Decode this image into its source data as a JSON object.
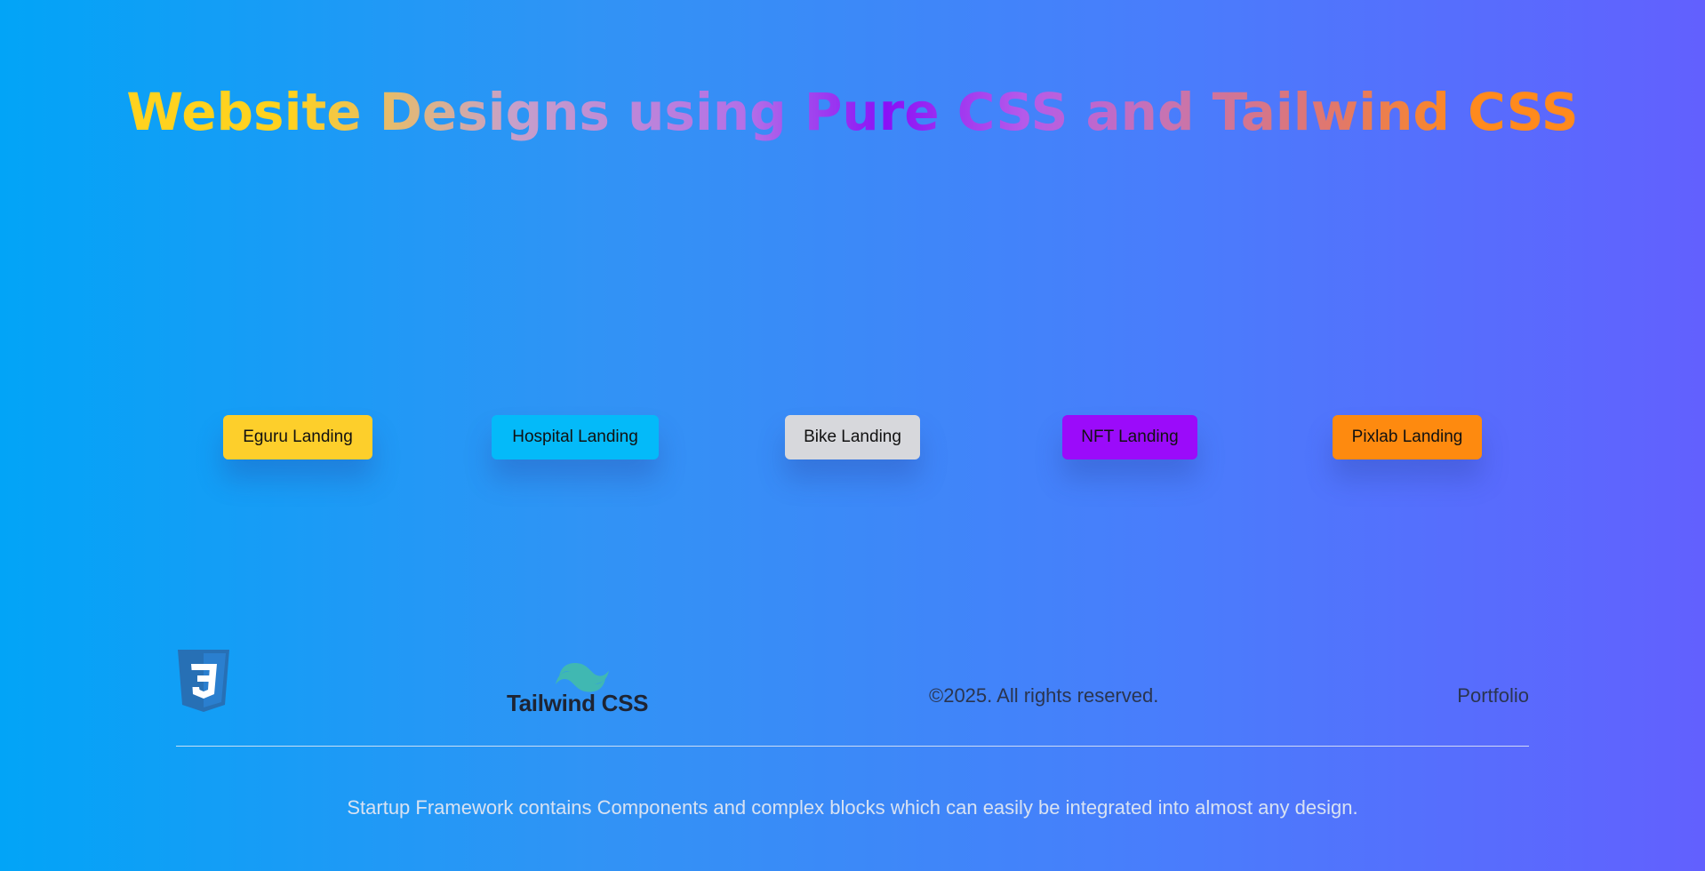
{
  "header": {
    "title": "Website Designs using Pure CSS and Tailwind CSS"
  },
  "buttons": [
    {
      "label": "Eguru Landing",
      "color": "#fdcf2b"
    },
    {
      "label": "Hospital Landing",
      "color": "#04baf9"
    },
    {
      "label": "Bike Landing",
      "color": "#d7d8dc"
    },
    {
      "label": "NFT Landing",
      "color": "#9b0bfa"
    },
    {
      "label": "Pixlab Landing",
      "color": "#fe8a0f"
    }
  ],
  "footer": {
    "css_logo_icon": "css3-logo-icon",
    "tailwind_logo_text": "Tailwind CSS",
    "tailwind_logo_icon": "tailwind-wave-icon",
    "copyright": "©2025. All rights reserved.",
    "portfolio_link": "Portfolio",
    "tagline": "Startup Framework contains Components and complex blocks which can easily be integrated into almost any design."
  }
}
